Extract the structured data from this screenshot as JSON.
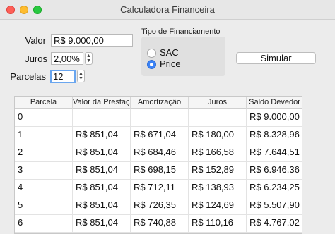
{
  "window": {
    "title": "Calculadora Financeira"
  },
  "form": {
    "valor_label": "Valor",
    "valor_value": "R$ 9.000,00",
    "juros_label": "Juros",
    "juros_value": "2,00%",
    "parcelas_label": "Parcelas",
    "parcelas_value": "12"
  },
  "financing": {
    "title": "Tipo de Financiamento",
    "options": [
      "SAC",
      "Price"
    ],
    "selected": "Price"
  },
  "actions": {
    "simular_label": "Simular"
  },
  "table": {
    "columns": [
      "Parcela",
      "Valor da Prestação",
      "Amortização",
      "Juros",
      "Saldo Devedor"
    ],
    "rows": [
      [
        "0",
        "",
        "",
        "",
        "R$ 9.000,00"
      ],
      [
        "1",
        "R$ 851,04",
        "R$ 671,04",
        "R$ 180,00",
        "R$ 8.328,96"
      ],
      [
        "2",
        "R$ 851,04",
        "R$ 684,46",
        "R$ 166,58",
        "R$ 7.644,51"
      ],
      [
        "3",
        "R$ 851,04",
        "R$ 698,15",
        "R$ 152,89",
        "R$ 6.946,36"
      ],
      [
        "4",
        "R$ 851,04",
        "R$ 712,11",
        "R$ 138,93",
        "R$ 6.234,25"
      ],
      [
        "5",
        "R$ 851,04",
        "R$ 726,35",
        "R$ 124,69",
        "R$ 5.507,90"
      ],
      [
        "6",
        "R$ 851,04",
        "R$ 740,88",
        "R$ 110,16",
        "R$ 4.767,02"
      ]
    ]
  }
}
